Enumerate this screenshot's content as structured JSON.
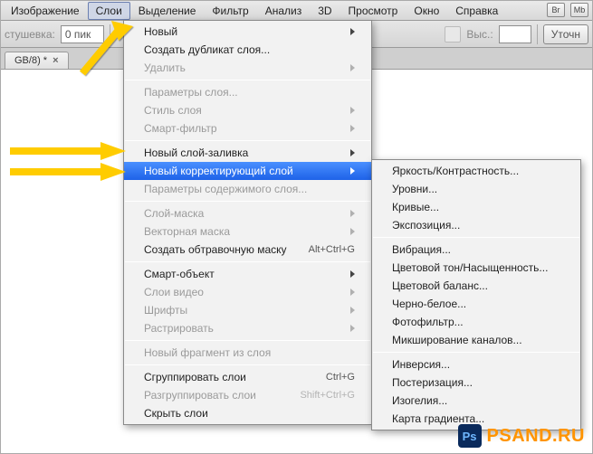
{
  "menubar": {
    "items": [
      "Изображение",
      "Слои",
      "Выделение",
      "Фильтр",
      "Анализ",
      "3D",
      "Просмотр",
      "Окно",
      "Справка"
    ],
    "active_index": 1,
    "right_buttons": [
      "Br",
      "Mb"
    ]
  },
  "toolbar": {
    "feather_label": "стушевка:",
    "feather_value": "0 пик",
    "highlabel": "Выс.:",
    "refine_button": "Уточн"
  },
  "tab": {
    "title": "GB/8) *",
    "close": "×"
  },
  "menu": {
    "items": [
      {
        "label": "Новый",
        "arrow": true
      },
      {
        "label": "Создать дубликат слоя..."
      },
      {
        "label": "Удалить",
        "arrow": true,
        "disabled": true
      },
      {
        "sep": true
      },
      {
        "label": "Параметры слоя...",
        "disabled": true
      },
      {
        "label": "Стиль слоя",
        "arrow": true,
        "disabled": true
      },
      {
        "label": "Смарт-фильтр",
        "arrow": true,
        "disabled": true
      },
      {
        "sep": true
      },
      {
        "label": "Новый слой-заливка",
        "arrow": true
      },
      {
        "label": "Новый корректирующий слой",
        "arrow": true,
        "highlight": true
      },
      {
        "label": "Параметры содержимого слоя...",
        "disabled": true
      },
      {
        "sep": true
      },
      {
        "label": "Слой-маска",
        "arrow": true,
        "disabled": true
      },
      {
        "label": "Векторная маска",
        "arrow": true,
        "disabled": true
      },
      {
        "label": "Создать обтравочную маску",
        "shortcut": "Alt+Ctrl+G"
      },
      {
        "sep": true
      },
      {
        "label": "Смарт-объект",
        "arrow": true
      },
      {
        "label": "Слои видео",
        "arrow": true,
        "disabled": true
      },
      {
        "label": "Шрифты",
        "arrow": true,
        "disabled": true
      },
      {
        "label": "Растрировать",
        "arrow": true,
        "disabled": true
      },
      {
        "sep": true
      },
      {
        "label": "Новый фрагмент из слоя",
        "disabled": true
      },
      {
        "sep": true
      },
      {
        "label": "Сгруппировать слои",
        "shortcut": "Ctrl+G"
      },
      {
        "label": "Разгруппировать слои",
        "shortcut": "Shift+Ctrl+G",
        "disabled": true
      },
      {
        "label": "Скрыть слои"
      }
    ]
  },
  "submenu": {
    "items": [
      {
        "label": "Яркость/Контрастность..."
      },
      {
        "label": "Уровни..."
      },
      {
        "label": "Кривые..."
      },
      {
        "label": "Экспозиция..."
      },
      {
        "sep": true
      },
      {
        "label": "Вибрация..."
      },
      {
        "label": "Цветовой тон/Насыщенность..."
      },
      {
        "label": "Цветовой баланс..."
      },
      {
        "label": "Черно-белое..."
      },
      {
        "label": "Фотофильтр..."
      },
      {
        "label": "Микширование каналов..."
      },
      {
        "sep": true
      },
      {
        "label": "Инверсия..."
      },
      {
        "label": "Постеризация..."
      },
      {
        "label": "Изогелия..."
      },
      {
        "label": "Карта градиента..."
      }
    ]
  },
  "watermark": {
    "ps": "Ps",
    "text": "PSAND.RU"
  }
}
